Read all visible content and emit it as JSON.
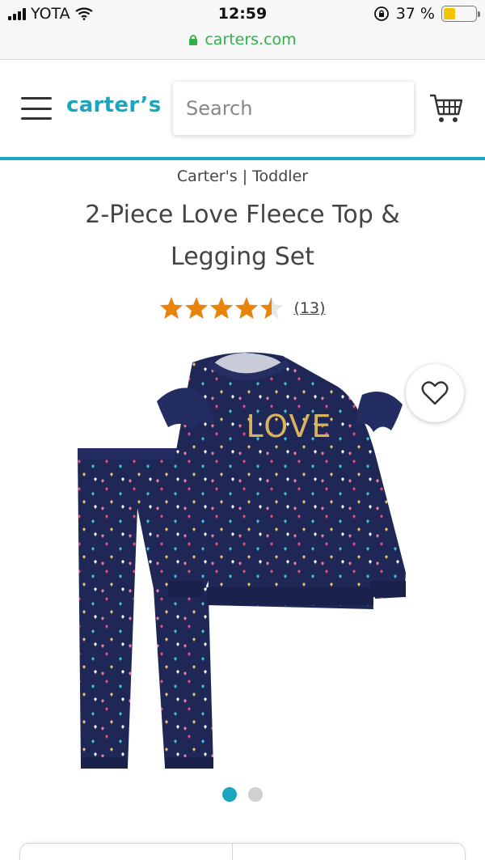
{
  "status_bar": {
    "carrier": "YOTA",
    "time": "12:59",
    "battery_percent": "37 %",
    "battery_level": 0.37,
    "url": "carters.com"
  },
  "header": {
    "logo": "carter’s",
    "search_placeholder": "Search"
  },
  "product": {
    "breadcrumb": "Carter's | Toddler",
    "title": "2-Piece Love Fleece Top & Legging Set",
    "rating": 4.5,
    "rating_max": 5,
    "review_count": "(13)",
    "shirt_text": "LOVE"
  },
  "gallery": {
    "total_images": 2,
    "active_index": 0
  },
  "colors": {
    "brand": "#1aa5c0",
    "star": "#e8830c",
    "url_green": "#2fb24c",
    "garment_navy": "#1e2756"
  }
}
